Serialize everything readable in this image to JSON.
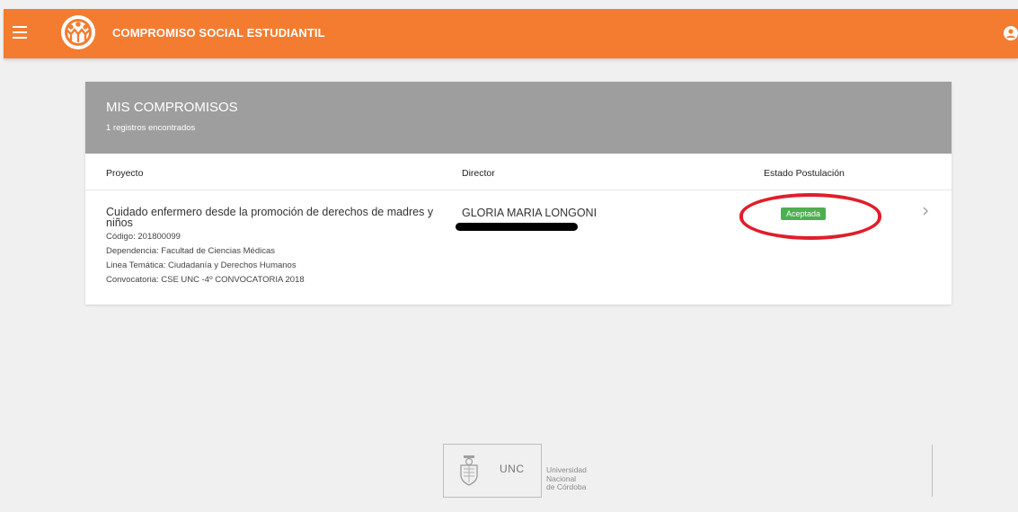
{
  "header": {
    "app_title": "COMPROMISO SOCIAL ESTUDIANTIL",
    "menu_icon": "hamburger-menu-icon",
    "logo_icon": "people-circle-logo",
    "user_icon": "user-account-icon",
    "brand_color": "#f47c30"
  },
  "card": {
    "title": "MIS COMPROMISOS",
    "subtitle": "1 registros encontrados",
    "header_color": "#9e9e9e",
    "columns": {
      "project": "Proyecto",
      "director": "Director",
      "status": "Estado Postulación"
    },
    "rows": [
      {
        "project_name": "Cuidado enfermero desde la promoción de derechos de madres y niños",
        "codigo": "Código: 201800099",
        "dependencia": "Dependencia: Facultad de Ciencias Médicas",
        "linea": "Linea Temática: Ciudadanía y Derechos Humanos",
        "convocatoria": "Convocatoria: CSE UNC -4º CONVOCATORIA 2018",
        "director": "GLORIA MARIA LONGONI",
        "status": "Aceptada",
        "status_color": "#4caf50",
        "row_icon": "chevron-right-icon"
      }
    ]
  },
  "annotation": {
    "highlight_color": "#e01e2b"
  },
  "footer": {
    "emblem_icon": "university-shield-icon",
    "unc_label": "UNC",
    "university_line1": "Universidad",
    "university_line2": "Nacional",
    "university_line3": "de Córdoba"
  }
}
